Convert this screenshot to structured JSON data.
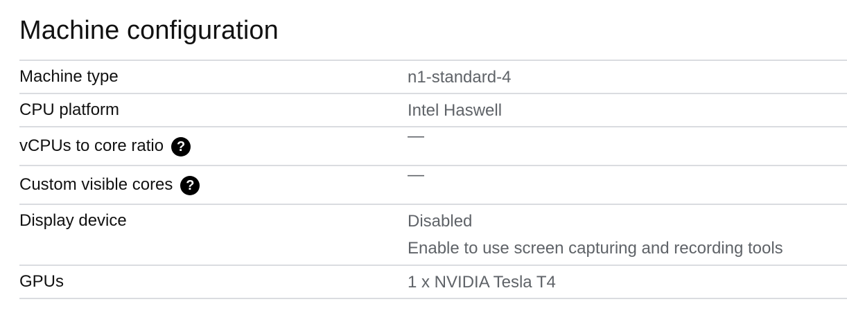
{
  "section": {
    "title": "Machine configuration"
  },
  "rows": [
    {
      "label": "Machine type",
      "value": "n1-standard-4"
    },
    {
      "label": "CPU platform",
      "value": "Intel Haswell"
    },
    {
      "label": "vCPUs to core ratio",
      "value": "—",
      "help_icon": "help-circle-icon"
    },
    {
      "label": "Custom visible cores",
      "value": "—",
      "help_icon": "help-circle-icon"
    },
    {
      "label": "Display device",
      "value": "Disabled",
      "sub_value": "Enable to use screen capturing and recording tools"
    },
    {
      "label": "GPUs",
      "value": "1 x NVIDIA Tesla T4"
    }
  ],
  "icons": {
    "help_glyph": "?"
  }
}
